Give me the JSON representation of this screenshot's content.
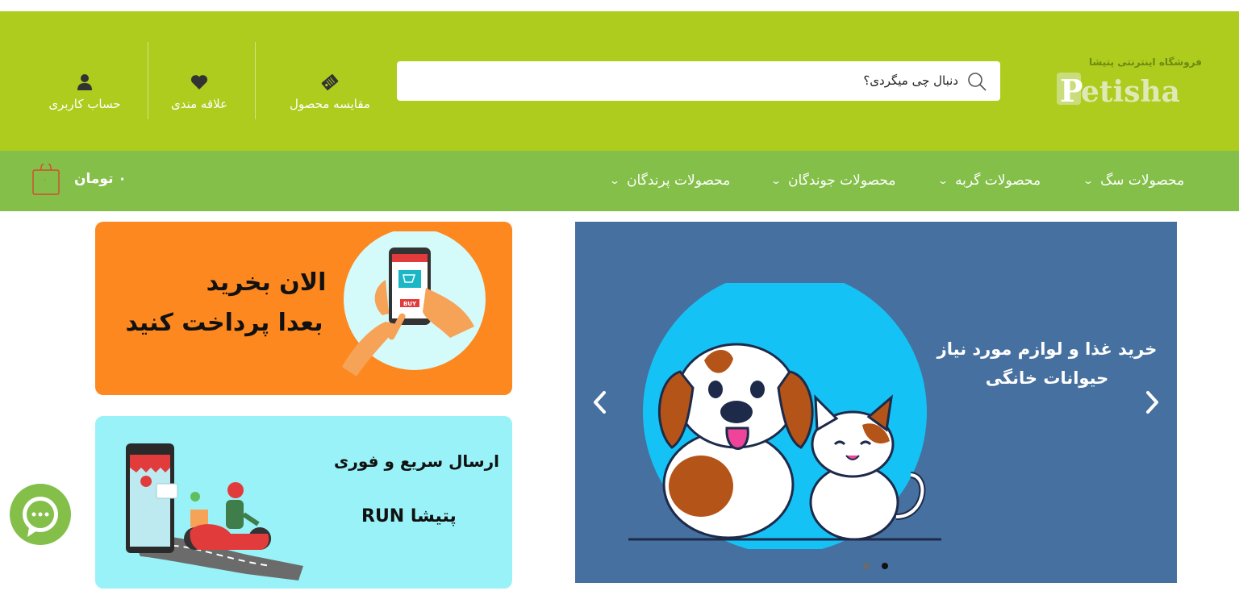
{
  "brand": {
    "tagline": "فروشگاه اینترنتی پتیشا",
    "wordmark": "Petisha",
    "color_primary": "#adcc1e",
    "color_nav": "#84bf4a"
  },
  "search": {
    "placeholder": "دنبال چی میگردی؟",
    "icon": "search-icon"
  },
  "header_actions": {
    "compare_label": "مقایسه محصول",
    "wishlist_label": "علاقه مندی",
    "account_label": "حساب کاربری"
  },
  "nav": {
    "items": [
      {
        "label": "محصولات سگ"
      },
      {
        "label": "محصولات گربه"
      },
      {
        "label": "محصولات جوندگان"
      },
      {
        "label": "محصولات پرندگان"
      }
    ],
    "cart_total": "۰ تومان",
    "cart_count": "۰"
  },
  "banners": {
    "orange": {
      "line1": "الان بخرید",
      "line2": "بعدا پرداخت کنید",
      "phone_button": "BUY",
      "color": "#fc881f"
    },
    "cyan": {
      "line1": "ارسال سریع و فوری",
      "line2": "پتیشا RUN",
      "color": "#99f2f7"
    }
  },
  "slider": {
    "text_line1": "خرید غذا و لوازم مورد نیاز",
    "text_line2": "حیوانات خانگی",
    "slide_count": 2,
    "active_slide": 2,
    "color": "#46709f"
  }
}
